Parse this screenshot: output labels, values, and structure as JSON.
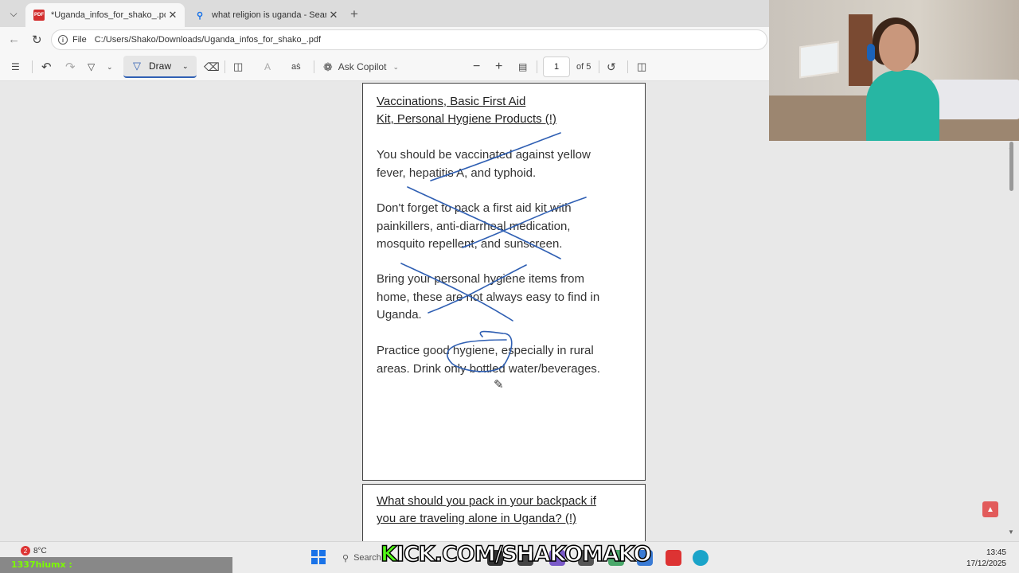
{
  "browser": {
    "tabs": [
      {
        "title": "*Uganda_infos_for_shako_.pdf",
        "icon": "pdf-icon",
        "active": true
      },
      {
        "title": "what religion is uganda - Search",
        "icon": "search-icon",
        "active": false
      }
    ],
    "address": {
      "scheme": "File",
      "url": "C:/Users/Shako/Downloads/Uganda_infos_for_shako_.pdf"
    }
  },
  "pdf_toolbar": {
    "draw_label": "Draw",
    "copilot_label": "Ask Copilot",
    "page_current": "1",
    "page_total": "of 5"
  },
  "document": {
    "section1_heading_line1": "Vaccinations, Basic First Aid",
    "section1_heading_line2": "Kit, Personal Hygiene Products (!)",
    "para1_line1": "You should be vaccinated against yellow",
    "para1_line2": "fever, hepatitis A, and typhoid.",
    "para2_line1": "Don't forget to pack a first aid kit with",
    "para2_line2": "painkillers, anti-diarrheal medication,",
    "para2_line3": "mosquito repellent, and sunscreen.",
    "para3_line1": "Bring your personal hygiene items from",
    "para3_line2": "home, these are not always easy to find in",
    "para3_line3": "Uganda.",
    "para4_line1": "Practice good hygiene, especially in rural",
    "para4_line2": "areas. Drink only bottled water/beverages.",
    "section2_heading_line1": "What should you pack in your backpack if",
    "section2_heading_line2": "you are traveling alone in Uganda? (!)",
    "ink_color": "#2f5fb3"
  },
  "taskbar": {
    "weather": "8°C",
    "notification_count": "2",
    "chat_user": "1337hiumx :",
    "search_label": "Search",
    "overlay_text_k": "K",
    "overlay_text_rest": "ICK.COM/SHAKOMAKO",
    "time": "13:45",
    "date": "17/12/2025"
  }
}
